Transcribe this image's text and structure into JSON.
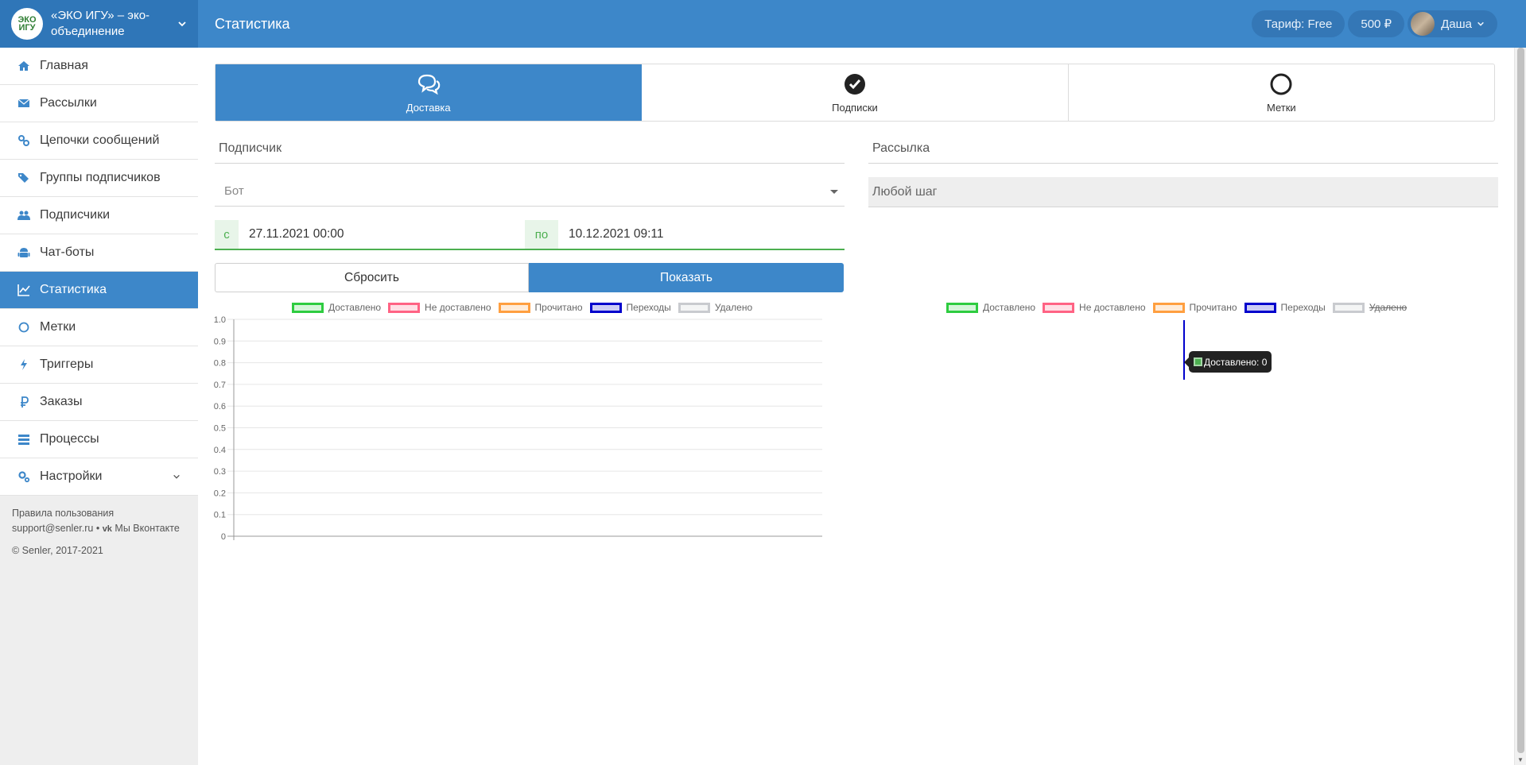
{
  "header": {
    "brand_logo_text": "ЭКО ИГУ",
    "brand_name": "«ЭКО ИГУ» – эко-объединение",
    "page_title": "Статистика",
    "tariff": "Тариф: Free",
    "balance": "500 ₽",
    "user": "Даша"
  },
  "sidebar": {
    "items": [
      {
        "label": "Главная",
        "icon": "home-icon"
      },
      {
        "label": "Рассылки",
        "icon": "envelope-icon"
      },
      {
        "label": "Цепочки сообщений",
        "icon": "link-icon"
      },
      {
        "label": "Группы подписчиков",
        "icon": "tags-icon"
      },
      {
        "label": "Подписчики",
        "icon": "users-icon"
      },
      {
        "label": "Чат-боты",
        "icon": "android-icon"
      },
      {
        "label": "Статистика",
        "icon": "chart-icon",
        "active": true
      },
      {
        "label": "Метки",
        "icon": "circle-icon"
      },
      {
        "label": "Триггеры",
        "icon": "bolt-icon"
      },
      {
        "label": "Заказы",
        "icon": "ruble-icon"
      },
      {
        "label": "Процессы",
        "icon": "tasks-icon"
      },
      {
        "label": "Настройки",
        "icon": "cogs-icon"
      }
    ],
    "footer": {
      "terms": "Правила пользования",
      "email": "support@senler.ru",
      "separator": "•",
      "vk": "Мы Вконтакте",
      "copyright": "© Senler, 2017-2021"
    }
  },
  "tabs": [
    {
      "label": "Доставка",
      "icon": "comments-icon",
      "active": true
    },
    {
      "label": "Подписки",
      "icon": "check-circle-icon"
    },
    {
      "label": "Метки",
      "icon": "circle-icon"
    }
  ],
  "filters": {
    "subscriber_label": "Подписчик",
    "bot_placeholder": "Бот",
    "mailing_label": "Рассылка",
    "step_value": "Любой шаг",
    "from_prefix": "с",
    "from_value": "27.11.2021 00:00",
    "to_prefix": "по",
    "to_value": "10.12.2021 09:11",
    "reset_label": "Сбросить",
    "show_label": "Показать"
  },
  "colors": {
    "accent": "#3d87c9",
    "delivered": "#2ecc40",
    "not_delivered": "#ff6384",
    "read": "#ff9f40",
    "clicks": "#0000cc",
    "deleted": "#c9cbcf"
  },
  "chart_data": [
    {
      "type": "line",
      "series": [
        {
          "name": "Доставлено",
          "values": []
        },
        {
          "name": "Не доставлено",
          "values": []
        },
        {
          "name": "Прочитано",
          "values": []
        },
        {
          "name": "Переходы",
          "values": []
        },
        {
          "name": "Удалено",
          "values": []
        }
      ],
      "yticks": [
        "1.0",
        "0.9",
        "0.8",
        "0.7",
        "0.6",
        "0.5",
        "0.4",
        "0.3",
        "0.2",
        "0.1",
        "0"
      ],
      "ylim": [
        0,
        1
      ],
      "grid": true,
      "legend": "top"
    },
    {
      "type": "bar",
      "series": [
        {
          "name": "Доставлено",
          "values": [
            0
          ]
        },
        {
          "name": "Не доставлено",
          "values": []
        },
        {
          "name": "Прочитано",
          "values": []
        },
        {
          "name": "Переходы",
          "values": []
        },
        {
          "name": "Удалено",
          "values": [],
          "hidden": true
        }
      ],
      "tooltip": "Доставлено: 0",
      "legend": "top"
    }
  ]
}
